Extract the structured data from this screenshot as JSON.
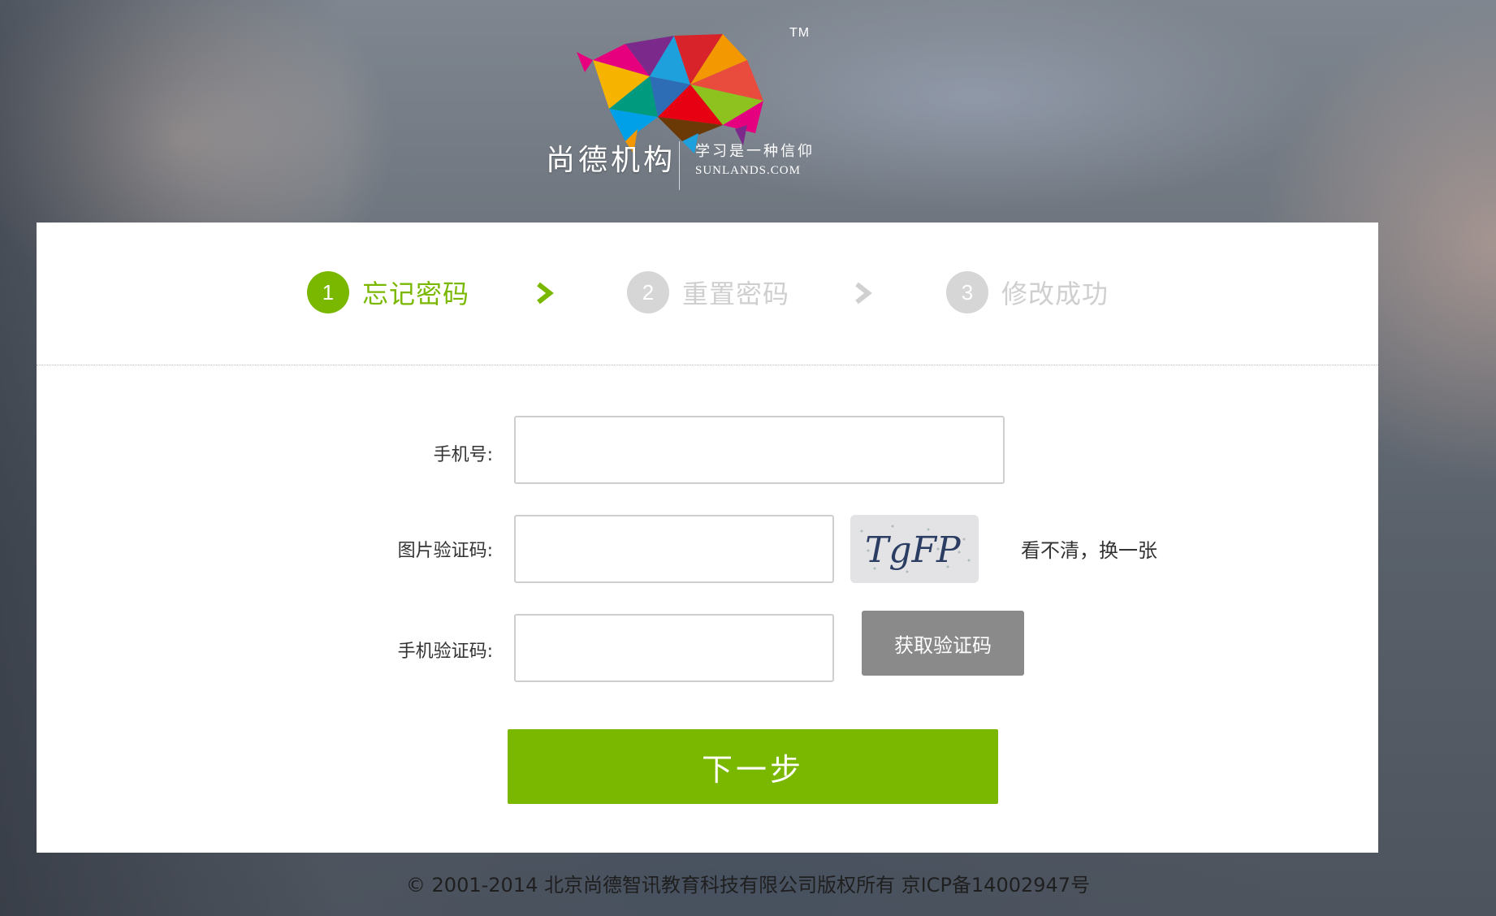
{
  "logo": {
    "brand_cn": "尚德机构",
    "slogan": "学习是一种信仰",
    "domain": "SUNLANDS.COM",
    "tm": "TM"
  },
  "steps": [
    {
      "number": "1",
      "label": "忘记密码",
      "state": "active"
    },
    {
      "number": "2",
      "label": "重置密码",
      "state": "inactive"
    },
    {
      "number": "3",
      "label": "修改成功",
      "state": "inactive"
    }
  ],
  "form": {
    "phone_label": "手机号:",
    "phone_value": "",
    "captcha_label": "图片验证码:",
    "captcha_value": "",
    "captcha_text": "TgFP",
    "captcha_refresh": "看不清，换一张",
    "sms_label": "手机验证码:",
    "sms_value": "",
    "sms_button": "获取验证码",
    "next_button": "下一步"
  },
  "footer": {
    "copyright": "© 2001-2014 北京尚德智讯教育科技有限公司版权所有 京ICP备14002947号"
  },
  "colors": {
    "accent": "#7ab800",
    "inactive": "#d6d6d6",
    "button_gray": "#8a8a8a"
  }
}
